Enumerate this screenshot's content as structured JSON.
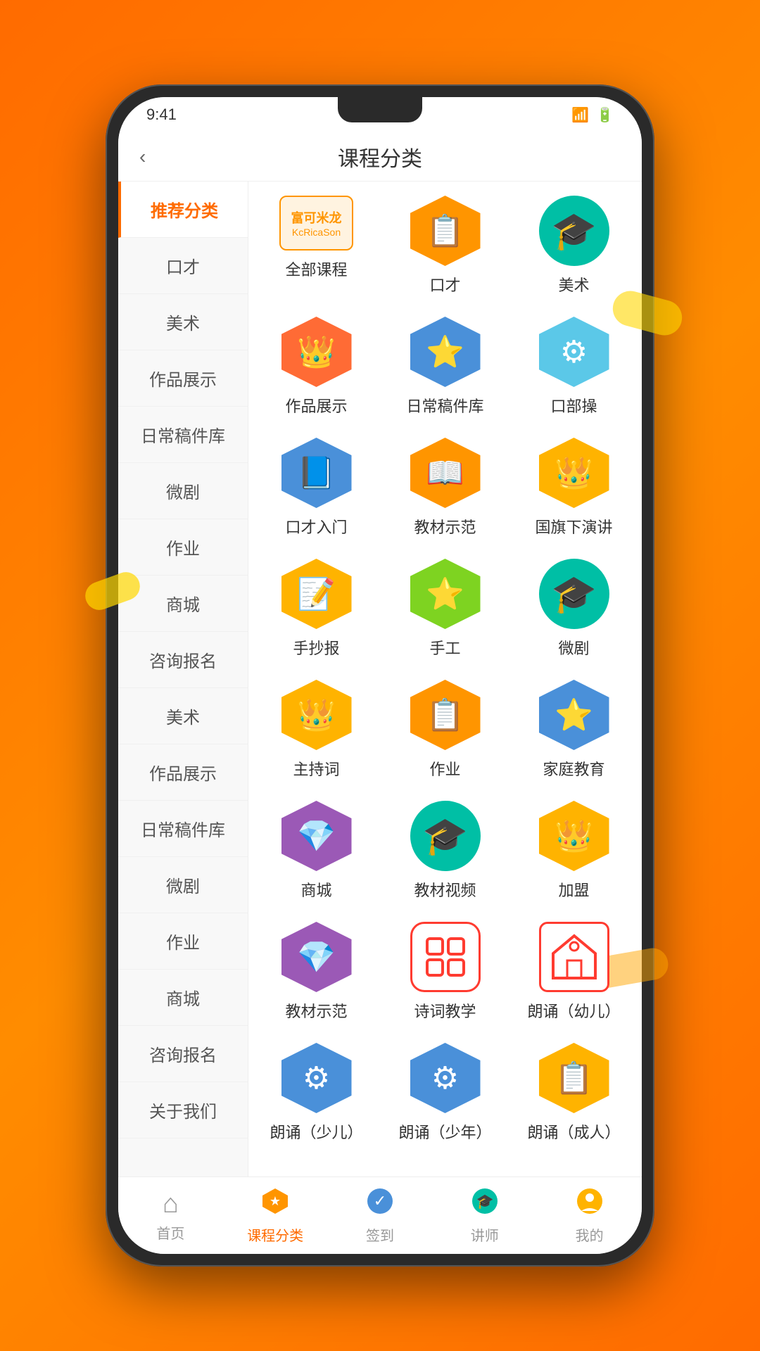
{
  "header": {
    "title": "课程分类",
    "back_label": "‹"
  },
  "sidebar": {
    "items": [
      {
        "id": "recommended",
        "label": "推荐分类",
        "active": true
      },
      {
        "id": "kouCai",
        "label": "口才"
      },
      {
        "id": "meishu1",
        "label": "美术"
      },
      {
        "id": "works1",
        "label": "作品展示"
      },
      {
        "id": "daily1",
        "label": "日常稿件库"
      },
      {
        "id": "wuJu1",
        "label": "微剧"
      },
      {
        "id": "zuoye1",
        "label": "作业"
      },
      {
        "id": "shop1",
        "label": "商城"
      },
      {
        "id": "consult1",
        "label": "咨询报名"
      },
      {
        "id": "meishu2",
        "label": "美术"
      },
      {
        "id": "works2",
        "label": "作品展示"
      },
      {
        "id": "daily2",
        "label": "日常稿件库"
      },
      {
        "id": "wuJu2",
        "label": "微剧"
      },
      {
        "id": "zuoye2",
        "label": "作业"
      },
      {
        "id": "shop2",
        "label": "商城"
      },
      {
        "id": "consult2",
        "label": "咨询报名"
      },
      {
        "id": "about",
        "label": "关于我们"
      }
    ]
  },
  "grid": {
    "items": [
      {
        "id": "all_courses",
        "label": "全部课程",
        "icon": "logo",
        "color": "#FF8C00",
        "shape": "logo"
      },
      {
        "id": "koucai",
        "label": "口才",
        "icon": "📋",
        "color": "#FF9500",
        "shape": "hex"
      },
      {
        "id": "meishu",
        "label": "美术",
        "icon": "🎓",
        "color": "#00BFA5",
        "shape": "circle"
      },
      {
        "id": "works",
        "label": "作品展示",
        "icon": "👑",
        "color": "#FF6B35",
        "shape": "hex"
      },
      {
        "id": "daily",
        "label": "日常稿件库",
        "icon": "⭐",
        "color": "#4A90D9",
        "shape": "hex"
      },
      {
        "id": "koubu",
        "label": "口部操",
        "icon": "⚙️",
        "color": "#5BC8E8",
        "shape": "hex"
      },
      {
        "id": "koucai_entry",
        "label": "口才入门",
        "icon": "⭐",
        "color": "#4A90D9",
        "shape": "hex"
      },
      {
        "id": "textbook_demo",
        "label": "教材示范",
        "icon": "📖",
        "color": "#FF9500",
        "shape": "hex"
      },
      {
        "id": "flag_speech",
        "label": "国旗下演讲",
        "icon": "👑",
        "color": "#FF9500",
        "shape": "hex"
      },
      {
        "id": "handwriting",
        "label": "手抄报",
        "icon": "📝",
        "color": "#FFB300",
        "shape": "hex"
      },
      {
        "id": "handwork",
        "label": "手工",
        "icon": "⭐",
        "color": "#7ED321",
        "shape": "hex"
      },
      {
        "id": "wuju",
        "label": "微剧",
        "icon": "🎓",
        "color": "#00BFA5",
        "shape": "circle"
      },
      {
        "id": "host",
        "label": "主持词",
        "icon": "👑",
        "color": "#FFB300",
        "shape": "hex"
      },
      {
        "id": "homework",
        "label": "作业",
        "icon": "📋",
        "color": "#FF9500",
        "shape": "hex"
      },
      {
        "id": "family_edu",
        "label": "家庭教育",
        "icon": "⭐",
        "color": "#4A90D9",
        "shape": "hex"
      },
      {
        "id": "shop",
        "label": "商城",
        "icon": "💎",
        "color": "#9B59B6",
        "shape": "hex"
      },
      {
        "id": "textbook_video",
        "label": "教材视频",
        "icon": "🎓",
        "color": "#00BFA5",
        "shape": "circle"
      },
      {
        "id": "join",
        "label": "加盟",
        "icon": "👑",
        "color": "#FFB300",
        "shape": "hex"
      },
      {
        "id": "textbook_demo2",
        "label": "教材示范",
        "icon": "💎",
        "color": "#9B59B6",
        "shape": "hex"
      },
      {
        "id": "poetry",
        "label": "诗词教学",
        "icon": "⬜⬜",
        "color": "#FF3B30",
        "shape": "grid"
      },
      {
        "id": "recitation_child",
        "label": "朗诵（幼儿）",
        "icon": "🏠",
        "color": "#FF3B30",
        "shape": "house"
      },
      {
        "id": "recitation_young",
        "label": "朗诵（少儿）",
        "icon": "⚙️",
        "color": "#4A90D9",
        "shape": "hex"
      },
      {
        "id": "recitation_teen",
        "label": "朗诵（少年）",
        "icon": "⚙️",
        "color": "#4A90D9",
        "shape": "hex"
      },
      {
        "id": "recitation_adult",
        "label": "朗诵（成人）",
        "icon": "📋",
        "color": "#FFB300",
        "shape": "hex"
      }
    ]
  },
  "bottom_nav": {
    "items": [
      {
        "id": "home",
        "label": "首页",
        "icon": "⌂",
        "active": false
      },
      {
        "id": "courses",
        "label": "课程分类",
        "icon": "★",
        "active": true
      },
      {
        "id": "checkin",
        "label": "签到",
        "icon": "✓",
        "active": false
      },
      {
        "id": "teacher",
        "label": "讲师",
        "icon": "🎓",
        "active": false
      },
      {
        "id": "mine",
        "label": "我的",
        "icon": "☺",
        "active": false
      }
    ]
  },
  "colors": {
    "orange": "#FF6B00",
    "active_sidebar": "#FF6B00",
    "accent": "#FF9500"
  }
}
